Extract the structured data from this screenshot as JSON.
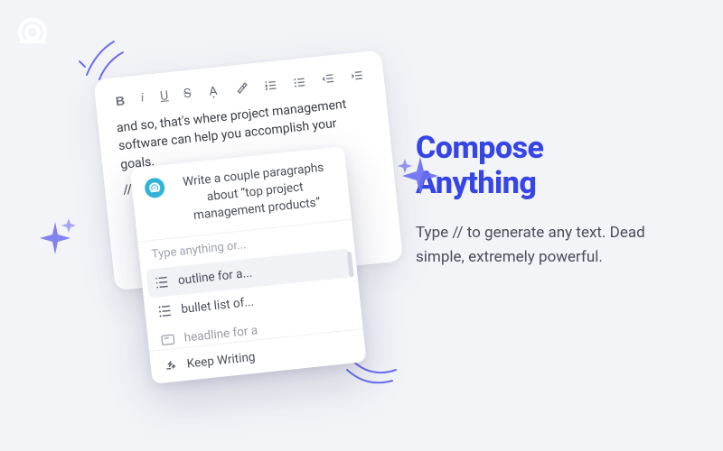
{
  "logo_name": "compose-logo",
  "headline_line1": "Compose",
  "headline_line2": "Anything",
  "subhead": "Type // to generate any text. Dead simple, extremely powerful.",
  "editor": {
    "doc_text": "and so, that's where project management software can help you accomplish your goals.",
    "slash": "//"
  },
  "toolbar": {
    "bold": "B",
    "italic": "i",
    "underline": "U",
    "strike": "S"
  },
  "popover": {
    "prompt": "Write a couple paragraphs about “top project management products”",
    "hint": "Type anything or...",
    "options": [
      {
        "label": "outline for a..."
      },
      {
        "label": "bullet list of..."
      },
      {
        "label": "headline for a"
      }
    ],
    "footer": "Keep Writing"
  }
}
